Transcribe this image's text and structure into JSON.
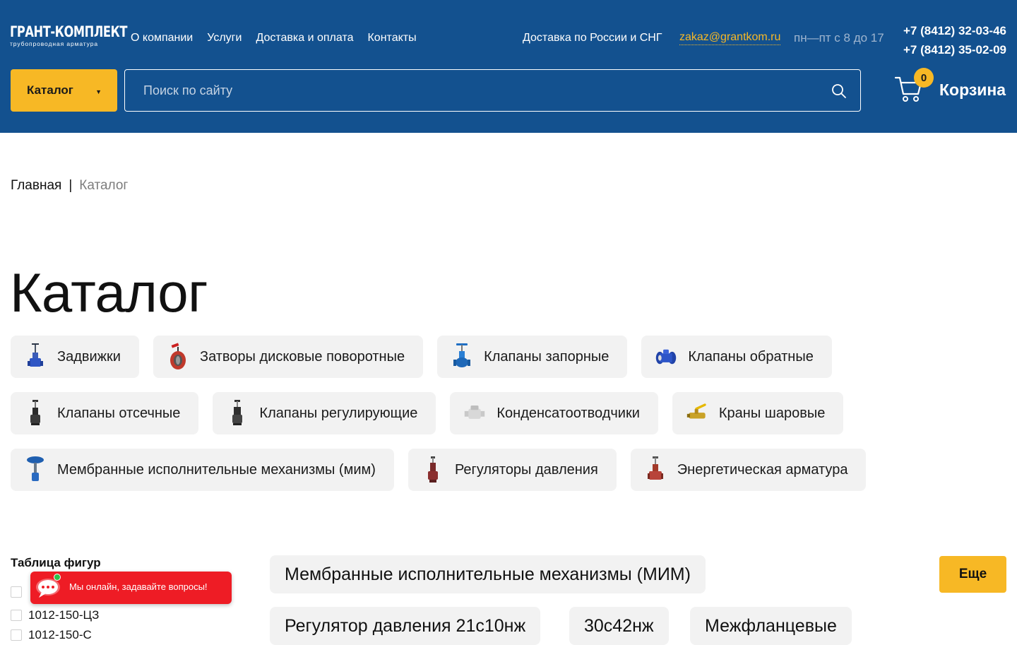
{
  "header": {
    "logo_main": "ГРАНТ-КОМПЛЕКТ",
    "logo_sub": "трубопроводная арматура",
    "nav": [
      "О компании",
      "Услуги",
      "Доставка и оплата",
      "Контакты"
    ],
    "delivery": "Доставка по России и СНГ",
    "email": "zakaz@grantkom.ru",
    "hours": "пн—пт с 8 до 17",
    "phones": [
      "+7 (8412) 32-03-46",
      "+7 (8412) 35-02-09"
    ],
    "catalog_button": "Каталог",
    "search_placeholder": "Поиск по сайту",
    "cart_count": "0",
    "cart_label": "Корзина"
  },
  "breadcrumb": {
    "home": "Главная",
    "separator": "|",
    "current": "Каталог"
  },
  "page_title": "Каталог",
  "categories": [
    {
      "label": "Задвижки",
      "icon": "gate-valve-icon"
    },
    {
      "label": "Затворы дисковые поворотные",
      "icon": "butterfly-valve-icon"
    },
    {
      "label": "Клапаны запорные",
      "icon": "globe-valve-icon"
    },
    {
      "label": "Клапаны обратные",
      "icon": "check-valve-icon"
    },
    {
      "label": "Клапаны отсечные",
      "icon": "shutoff-valve-icon"
    },
    {
      "label": "Клапаны регулирующие",
      "icon": "control-valve-icon"
    },
    {
      "label": "Конденсатоотводчики",
      "icon": "steam-trap-icon"
    },
    {
      "label": "Краны шаровые",
      "icon": "ball-valve-icon"
    },
    {
      "label": "Мембранные исполнительные механизмы (мим)",
      "icon": "diaphragm-actuator-icon"
    },
    {
      "label": "Регуляторы давления",
      "icon": "pressure-regulator-icon"
    },
    {
      "label": "Энергетическая арматура",
      "icon": "power-valve-icon"
    }
  ],
  "sidebar": {
    "title": "Таблица фигур",
    "items": [
      "1012-150-ЦЗ",
      "1012-150-С"
    ]
  },
  "chat": {
    "text": "Мы онлайн, задавайте вопросы!"
  },
  "tags": {
    "row1": [
      "Мембранные исполнительные механизмы (МИМ)"
    ],
    "row2": [
      "Регулятор давления 21с10нж",
      "30с42нж",
      "Межфланцевые"
    ],
    "more_button": "Еще"
  },
  "colors": {
    "header_bg": "#13518f",
    "accent": "#f7b825",
    "chip_bg": "#f2f2f2",
    "chat_bg": "#ee1c25"
  }
}
